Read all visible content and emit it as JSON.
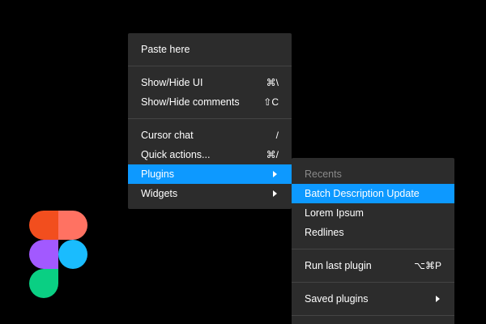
{
  "colors": {
    "background": "#000000",
    "menu_bg": "#2C2C2C",
    "highlight": "#0D99FF",
    "separator": "#444444",
    "disabled_text": "#8A8A8A",
    "logo_red": "#F24E1E",
    "logo_salmon": "#FF7262",
    "logo_purple": "#A259FF",
    "logo_blue": "#1ABCFE",
    "logo_green": "#0ACF83"
  },
  "context_menu": {
    "items": [
      {
        "label": "Paste here",
        "shortcut": ""
      },
      {
        "label": "Show/Hide UI",
        "shortcut": "⌘\\"
      },
      {
        "label": "Show/Hide comments",
        "shortcut": "⇧C"
      },
      {
        "label": "Cursor chat",
        "shortcut": "/"
      },
      {
        "label": "Quick actions...",
        "shortcut": "⌘/"
      },
      {
        "label": "Plugins",
        "shortcut": "",
        "submenu_icon": "chevron-right-icon",
        "highlighted": true
      },
      {
        "label": "Widgets",
        "shortcut": "",
        "submenu_icon": "chevron-right-icon"
      }
    ]
  },
  "plugins_submenu": {
    "section_label": "Recents",
    "items": [
      {
        "label": "Batch Description Update",
        "highlighted": true
      },
      {
        "label": "Lorem Ipsum"
      },
      {
        "label": "Redlines"
      },
      {
        "label": "Run last plugin",
        "shortcut": "⌥⌘P"
      },
      {
        "label": "Saved plugins",
        "submenu_icon": "chevron-right-icon"
      }
    ]
  },
  "logo": {
    "icon": "figma-logo-icon"
  }
}
